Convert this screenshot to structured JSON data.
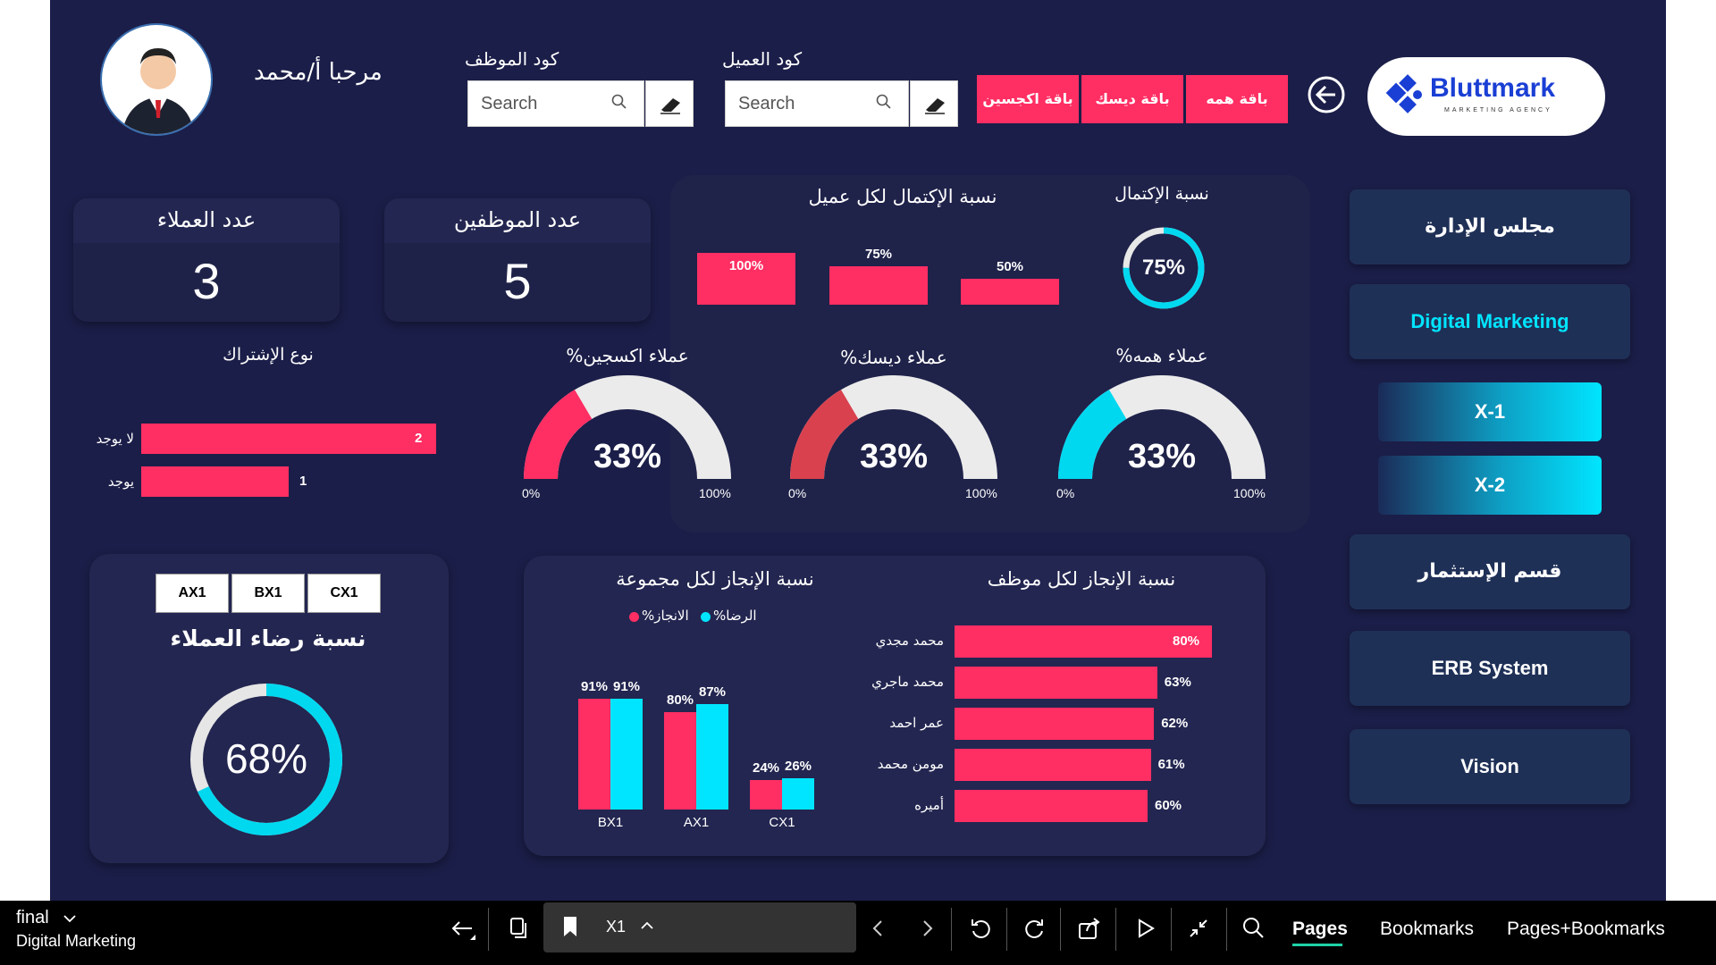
{
  "header": {
    "greeting": "مرحبا  أ/محمد",
    "employee_code_label": "كود الموظف",
    "client_code_label": "كود العميل",
    "search_placeholder": "Search",
    "packages": [
      "باقة اكجسين",
      "باقة ديسك",
      "باقة همه"
    ],
    "logo_text": "Bluttmark",
    "logo_sub": "MARKETING AGENCY"
  },
  "kpis": {
    "clients_label": "عدد العملاء",
    "clients_value": "3",
    "employees_label": "عدد الموظفين",
    "employees_value": "5"
  },
  "completion_per_client": {
    "title": "نسبة الإكتمال لكل عميل",
    "items": [
      {
        "label": "100%",
        "value": 100
      },
      {
        "label": "75%",
        "value": 75
      },
      {
        "label": "50%",
        "value": 50
      }
    ]
  },
  "completion_ratio": {
    "title": "نسبة الإكتمال",
    "value_label": "75%",
    "value": 0.75
  },
  "subscription_type": {
    "title": "نوع الإشتراك",
    "rows": [
      {
        "label": "لا يوجد",
        "value": 2
      },
      {
        "label": "يوجد",
        "value": 1
      }
    ]
  },
  "gauges": [
    {
      "title": "%عملاء اكسجين",
      "value_label": "33%",
      "value": 33,
      "min_label": "0%",
      "max_label": "100%",
      "color": "#ff2e63"
    },
    {
      "title": "%عملاء ديسك",
      "value_label": "33%",
      "value": 33,
      "min_label": "0%",
      "max_label": "100%",
      "color": "#d9414f"
    },
    {
      "title": "%عملاء همه",
      "value_label": "33%",
      "value": 33,
      "min_label": "0%",
      "max_label": "100%",
      "color": "#00d8f0"
    }
  ],
  "satisfaction": {
    "tabs": [
      "AX1",
      "BX1",
      "CX1"
    ],
    "title": "نسبة رضاء العملاء",
    "value_label": "68%",
    "value": 0.68
  },
  "group_achievement": {
    "title": "نسبة الإنجاز لكل مجموعة",
    "legend": [
      {
        "name": "%الانجاز",
        "color": "#ff2e63"
      },
      {
        "name": "%الرضا",
        "color": "#00e5ff"
      }
    ]
  },
  "employee_achievement": {
    "title": "نسبة الإنجاز لكل موظف"
  },
  "chart_data": [
    {
      "type": "bar",
      "title": "نسبة الإنجاز لكل مجموعة",
      "categories": [
        "BX1",
        "AX1",
        "CX1"
      ],
      "series": [
        {
          "name": "%الانجاز",
          "values": [
            91,
            80,
            24
          ],
          "labels": [
            "91%",
            "80%",
            "24%"
          ]
        },
        {
          "name": "%الرضا",
          "values": [
            91,
            87,
            26
          ],
          "labels": [
            "91%",
            "87%",
            "26%"
          ]
        }
      ],
      "ylim": [
        0,
        100
      ]
    },
    {
      "type": "bar",
      "title": "نسبة الإنجاز لكل موظف",
      "categories": [
        "محمد مجدي",
        "محمد ماجري",
        "عمر احمد",
        "مومن محمد",
        "أميره"
      ],
      "values": [
        80,
        63,
        62,
        61,
        60
      ],
      "labels": [
        "80%",
        "63%",
        "62%",
        "61%",
        "60%"
      ],
      "xlim": [
        0,
        100
      ]
    }
  ],
  "sidebar": {
    "items": [
      "مجلس الإدارة",
      "Digital Marketing",
      "X-1",
      "X-2",
      "قسم الإستثمار",
      "ERB System",
      "Vision"
    ]
  },
  "toolbar": {
    "file_name": "final",
    "page_name": "Digital Marketing",
    "bookmark_label": "X1",
    "tabs": [
      "Pages",
      "Bookmarks",
      "Pages+Bookmarks"
    ]
  }
}
